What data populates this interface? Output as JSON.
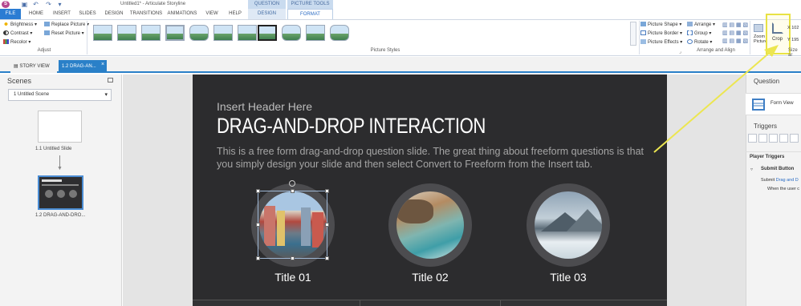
{
  "window": {
    "title": "Untitled1* - Articulate Storyline",
    "logo": "S"
  },
  "ribbon_tabs": [
    "FILE",
    "HOME",
    "INSERT",
    "SLIDES",
    "DESIGN",
    "TRANSITIONS",
    "ANIMATIONS",
    "VIEW",
    "HELP"
  ],
  "contextual_groups": {
    "question_tools": "QUESTION TOOLS",
    "picture_tools": "PICTURE TOOLS"
  },
  "contextual_tabs": {
    "design": "DESIGN",
    "format": "FORMAT"
  },
  "adjust": {
    "brightness": "Brightness",
    "contrast": "Contrast",
    "recolor": "Recolor",
    "replace_picture": "Replace Picture",
    "reset_picture": "Reset Picture",
    "label": "Adjust"
  },
  "picture_styles": {
    "label": "Picture Styles"
  },
  "picture_options": {
    "shape": "Picture Shape",
    "border": "Picture Border",
    "effects": "Picture Effects"
  },
  "arrange": {
    "arrange": "Arrange",
    "group": "Group",
    "rotate": "Rotate",
    "label": "Arrange and Align"
  },
  "zoom": {
    "label": "Zoom",
    "label2": "Picture"
  },
  "crop": {
    "label": "Crop"
  },
  "size": {
    "x_value": "102",
    "y_value": "195",
    "label": "Size ar"
  },
  "doc_tabs": {
    "story_view": "STORY VIEW",
    "slide": "1.2 DRAG-AN..."
  },
  "scenes": {
    "title": "Scenes",
    "selected": "1 Untitled Scene",
    "slides": [
      {
        "label": "1.1 Untitled Slide"
      },
      {
        "label": "1.2  DRAG-AND-DRO..."
      }
    ]
  },
  "slide": {
    "header_small": "Insert Header Here",
    "header_big": "DRAG-AND-DROP INTERACTION",
    "description": "This is a free form drag-and-drop question slide. The great thing about freeform questions is that you simply design your slide and then select Convert to Freeform from the Insert tab.",
    "items": [
      {
        "title": "Title 01"
      },
      {
        "title": "Title 02"
      },
      {
        "title": "Title 03"
      }
    ]
  },
  "right_panel": {
    "question_title": "Question",
    "form_view": "Form View",
    "triggers_title": "Triggers",
    "player_triggers": "Player Triggers",
    "submit_button": "Submit Button",
    "trigger_line1_a": "Submit ",
    "trigger_line1_b": "Drag and D",
    "trigger_line2": "When the user c"
  },
  "colors": {
    "accent": "#2b7cd3",
    "slide_bg": "#2c2c2e",
    "highlight": "#e8e243"
  }
}
